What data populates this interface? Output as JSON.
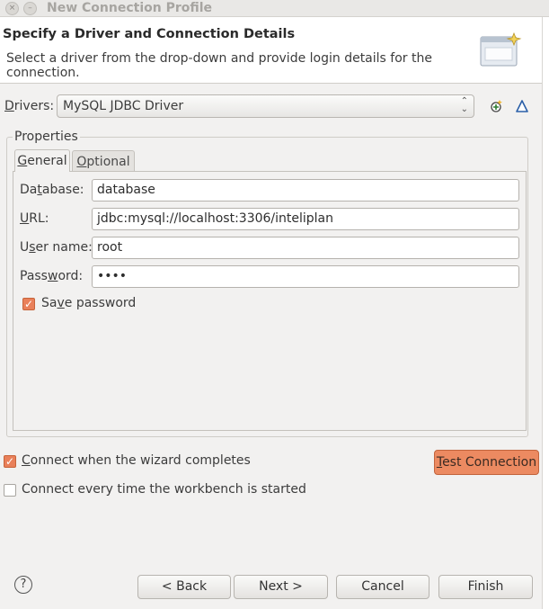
{
  "window": {
    "title": "New Connection Profile",
    "close_glyph": "×",
    "minimize_glyph": "–"
  },
  "header": {
    "title": "Specify a Driver and Connection Details",
    "description": "Select a driver from the drop-down and provide login details for the connection."
  },
  "drivers": {
    "label_underlined": "D",
    "label_rest": "rivers:",
    "selected": "MySQL JDBC Driver"
  },
  "properties": {
    "group_label": "Properties",
    "tabs": [
      {
        "pre": "",
        "key": "G",
        "post": "eneral",
        "active": true
      },
      {
        "pre": "",
        "key": "O",
        "post": "ptional",
        "active": false
      }
    ],
    "fields": {
      "database": {
        "pre": "Da",
        "key": "t",
        "post": "abase:",
        "value": "database"
      },
      "url": {
        "pre": "",
        "key": "U",
        "post": "RL:",
        "value": "jdbc:mysql://localhost:3306/inteliplan"
      },
      "username": {
        "pre": "U",
        "key": "s",
        "post": "er name:",
        "value": "root"
      },
      "password": {
        "pre": "Pass",
        "key": "w",
        "post": "ord:",
        "value": "••••"
      }
    },
    "save_password": {
      "pre": "Sa",
      "key": "v",
      "post": "e password",
      "checked": true
    }
  },
  "options": {
    "connect_on_finish": {
      "pre": "",
      "key": "C",
      "post": "onnect when the wizard completes",
      "checked": true
    },
    "connect_every_time": {
      "label": "Connect every time the workbench is started",
      "checked": false
    }
  },
  "test_connection": {
    "key": "T",
    "post": "est Connection"
  },
  "buttons": {
    "help": "?",
    "back": "< Back",
    "next": "Next >",
    "cancel": "Cancel",
    "finish": "Finish"
  },
  "colors": {
    "accent": "#ec8a61",
    "checkbox_on": "#e9805a",
    "window_bg": "#f2f1f0"
  },
  "icons": {
    "banner": "connection-wizard-icon",
    "new_driver": "new-driver-icon",
    "edit_driver": "edit-driver-icon"
  }
}
